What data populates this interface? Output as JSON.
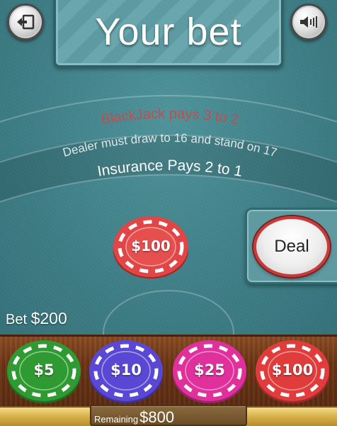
{
  "header": {
    "title": "Your bet",
    "exit_icon": "exit-icon",
    "sound_icon": "speaker-icon"
  },
  "table": {
    "rule_blackjack": "BlackJack pays 3 to 2",
    "rule_dealer": "Dealer must draw to 16 and stand on 17",
    "rule_insurance": "Insurance Pays 2 to 1",
    "felt_color": "#3f7f87"
  },
  "bet_area": {
    "placed_chip": "$100",
    "placed_chip_color": "#e03c3c"
  },
  "deal_button": {
    "label": "Deal"
  },
  "bet_display": {
    "label": "Bet",
    "amount": "$200"
  },
  "chip_tray": {
    "chips": [
      {
        "label": "$5",
        "color": "#2f9a32"
      },
      {
        "label": "$10",
        "color": "#5a48d4"
      },
      {
        "label": "$25",
        "color": "#e0309c"
      },
      {
        "label": "$100",
        "color": "#e03c3c"
      }
    ]
  },
  "footer": {
    "remaining_label": "Remaining",
    "remaining_value": "$800"
  }
}
